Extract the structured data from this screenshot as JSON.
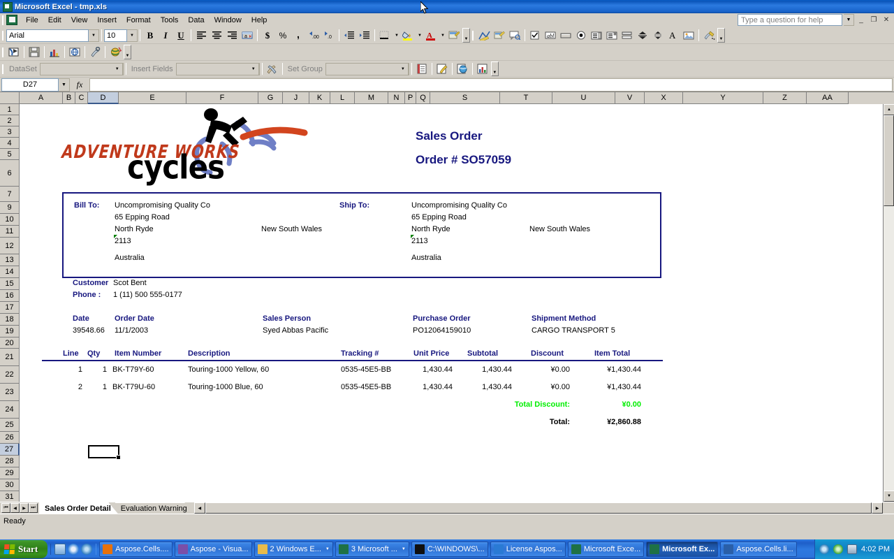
{
  "window": {
    "title": "Microsoft Excel - tmp.xls",
    "app_icon": "excel-icon",
    "minimize": "_",
    "restore": "❐",
    "close": "✕"
  },
  "menu": {
    "items": [
      "File",
      "Edit",
      "View",
      "Insert",
      "Format",
      "Tools",
      "Data",
      "Window",
      "Help"
    ],
    "help_placeholder": "Type a question for help"
  },
  "formatting_toolbar": {
    "font_name": "Arial",
    "font_size": "10",
    "bold": "B",
    "italic": "I",
    "underline": "U",
    "align_left": "align-left-icon",
    "align_center": "align-center-icon",
    "align_right": "align-right-icon",
    "merge_center": "merge-center-icon",
    "currency": "$",
    "percent": "%",
    "comma": ",",
    "increase_decimal": "increase-decimal-icon",
    "decrease_decimal": "decrease-decimal-icon",
    "decrease_indent": "decrease-indent-icon",
    "increase_indent": "increase-indent-icon",
    "borders": "borders-icon",
    "fill_color": "fill-color-icon",
    "font_color": "font-color-icon",
    "properties": "properties-icon"
  },
  "dataset_toolbar": {
    "dataset_label": "DataSet",
    "dataset_value": "",
    "insert_fields_label": "Insert Fields",
    "insert_fields_value": "",
    "set_group_label": "Set Group",
    "set_group_value": ""
  },
  "formula_bar": {
    "name_box": "D27",
    "fx": "fx",
    "formula": ""
  },
  "grid": {
    "columns": [
      {
        "label": "A",
        "width": 62
      },
      {
        "label": "B",
        "width": 18
      },
      {
        "label": "C",
        "width": 18
      },
      {
        "label": "D",
        "width": 44,
        "selected": true
      },
      {
        "label": "E",
        "width": 97
      },
      {
        "label": "F",
        "width": 103
      },
      {
        "label": "G",
        "width": 35
      },
      {
        "label": "J",
        "width": 38
      },
      {
        "label": "K",
        "width": 30
      },
      {
        "label": "L",
        "width": 35
      },
      {
        "label": "M",
        "width": 48
      },
      {
        "label": "N",
        "width": 24
      },
      {
        "label": "P",
        "width": 16
      },
      {
        "label": "Q",
        "width": 20
      },
      {
        "label": "S",
        "width": 100
      },
      {
        "label": "T",
        "width": 75
      },
      {
        "label": "U",
        "width": 90
      },
      {
        "label": "V",
        "width": 42
      },
      {
        "label": "X",
        "width": 55
      },
      {
        "label": "Y",
        "width": 115
      },
      {
        "label": "Z",
        "width": 62
      },
      {
        "label": "AA",
        "width": 60
      }
    ],
    "rows": [
      {
        "label": "1",
        "height": 16
      },
      {
        "label": "2",
        "height": 16
      },
      {
        "label": "3",
        "height": 16
      },
      {
        "label": "4",
        "height": 16
      },
      {
        "label": "5",
        "height": 16
      },
      {
        "label": "6",
        "height": 38
      },
      {
        "label": "7",
        "height": 22
      },
      {
        "label": "9",
        "height": 17
      },
      {
        "label": "10",
        "height": 17
      },
      {
        "label": "11",
        "height": 17
      },
      {
        "label": "12",
        "height": 24
      },
      {
        "label": "13",
        "height": 17
      },
      {
        "label": "14",
        "height": 17
      },
      {
        "label": "15",
        "height": 17
      },
      {
        "label": "16",
        "height": 17
      },
      {
        "label": "17",
        "height": 17
      },
      {
        "label": "18",
        "height": 17
      },
      {
        "label": "19",
        "height": 17
      },
      {
        "label": "20",
        "height": 16
      },
      {
        "label": "21",
        "height": 25
      },
      {
        "label": "22",
        "height": 25
      },
      {
        "label": "23",
        "height": 25
      },
      {
        "label": "24",
        "height": 25
      },
      {
        "label": "25",
        "height": 19
      },
      {
        "label": "26",
        "height": 17
      },
      {
        "label": "27",
        "height": 17,
        "selected": true
      },
      {
        "label": "28",
        "height": 17
      },
      {
        "label": "29",
        "height": 17
      },
      {
        "label": "30",
        "height": 17
      },
      {
        "label": "31",
        "height": 17
      }
    ]
  },
  "document": {
    "logo": {
      "line1": "ADVENTURE WORKS",
      "line2": "cycles",
      "line1_color": "#c0391b",
      "line2_color": "#000000",
      "cyclist_icon": "cyclist-icon"
    },
    "title": "Sales Order",
    "order_number": "Order # SO57059",
    "title_color": "#17177f",
    "bill_to": {
      "label": "Bill To:",
      "company": "Uncompromising Quality Co",
      "street": "65 Epping Road",
      "city": "North Ryde",
      "state": "New South Wales",
      "postal": "2113",
      "country": "Australia"
    },
    "ship_to": {
      "label": "Ship To:",
      "company": "Uncompromising Quality Co",
      "street": "65 Epping Road",
      "city": "North Ryde",
      "state": "New South Wales",
      "postal": "2113",
      "country": "Australia"
    },
    "customer": {
      "label": "Customer",
      "value": "Scot Bent"
    },
    "phone": {
      "label": "Phone :",
      "value": "1 (11) 500 555-0177"
    },
    "meta": [
      {
        "label": "Date",
        "value": "39548.66"
      },
      {
        "label": "Order Date",
        "value": "11/1/2003"
      },
      {
        "label": "Sales Person",
        "value": "Syed Abbas Pacific"
      },
      {
        "label": "Purchase Order",
        "value": "PO12064159010"
      },
      {
        "label": "Shipment Method",
        "value": "CARGO TRANSPORT 5"
      }
    ],
    "table": {
      "headers": [
        "Line",
        "Qty",
        "Item Number",
        "Description",
        "Tracking #",
        "Unit Price",
        "Subtotal",
        "Discount",
        "Item Total"
      ],
      "rows": [
        {
          "line": "1",
          "qty": "1",
          "item_number": "BK-T79Y-60",
          "description": "Touring-1000 Yellow, 60",
          "tracking": "0535-45E5-BB",
          "unit_price": "1,430.44",
          "subtotal": "1,430.44",
          "discount": "¥0.00",
          "item_total": "¥1,430.44"
        },
        {
          "line": "2",
          "qty": "1",
          "item_number": "BK-T79U-60",
          "description": "Touring-1000 Blue, 60",
          "tracking": "0535-45E5-BB",
          "unit_price": "1,430.44",
          "subtotal": "1,430.44",
          "discount": "¥0.00",
          "item_total": "¥1,430.44"
        }
      ],
      "total_discount_label": "Total Discount:",
      "total_discount_value": "¥0.00",
      "total_discount_color": "#00ee00",
      "total_label": "Total:",
      "total_value": "¥2,860.88"
    }
  },
  "sheet_tabs": {
    "tabs": [
      {
        "label": "Sales Order Detail",
        "active": true
      },
      {
        "label": "Evaluation Warning",
        "active": false
      }
    ],
    "nav_first": "⏮",
    "nav_prev": "◀",
    "nav_next": "▶",
    "nav_last": "⏭"
  },
  "status_bar": {
    "text": "Ready"
  },
  "taskbar": {
    "start": "Start",
    "quick_launch": [
      "show-desktop-icon",
      "internet-explorer-icon",
      "media-player-icon"
    ],
    "tasks": [
      {
        "label": "Aspose.Cells....",
        "icon": "aspose-icon",
        "active": false,
        "group": false
      },
      {
        "label": "Aspose - Visua...",
        "icon": "visual-studio-icon",
        "active": false,
        "group": false
      },
      {
        "label": "2 Windows E...",
        "icon": "folder-icon",
        "active": false,
        "group": true
      },
      {
        "label": "3 Microsoft ...",
        "icon": "excel-icon",
        "active": false,
        "group": true
      },
      {
        "label": "C:\\WINDOWS\\...",
        "icon": "console-icon",
        "active": false,
        "group": false
      },
      {
        "label": "License Aspos...",
        "icon": "browser-icon",
        "active": false,
        "group": false
      },
      {
        "label": "Microsoft Exce...",
        "icon": "excel-icon",
        "active": false,
        "group": false
      },
      {
        "label": "Microsoft Ex...",
        "icon": "excel-icon",
        "active": true,
        "group": false
      },
      {
        "label": "Aspose.Cells.li...",
        "icon": "word-icon",
        "active": false,
        "group": false
      }
    ],
    "tray_icons": [
      "network-icon",
      "update-icon",
      "printer-icon"
    ],
    "clock": "4:02 PM"
  }
}
